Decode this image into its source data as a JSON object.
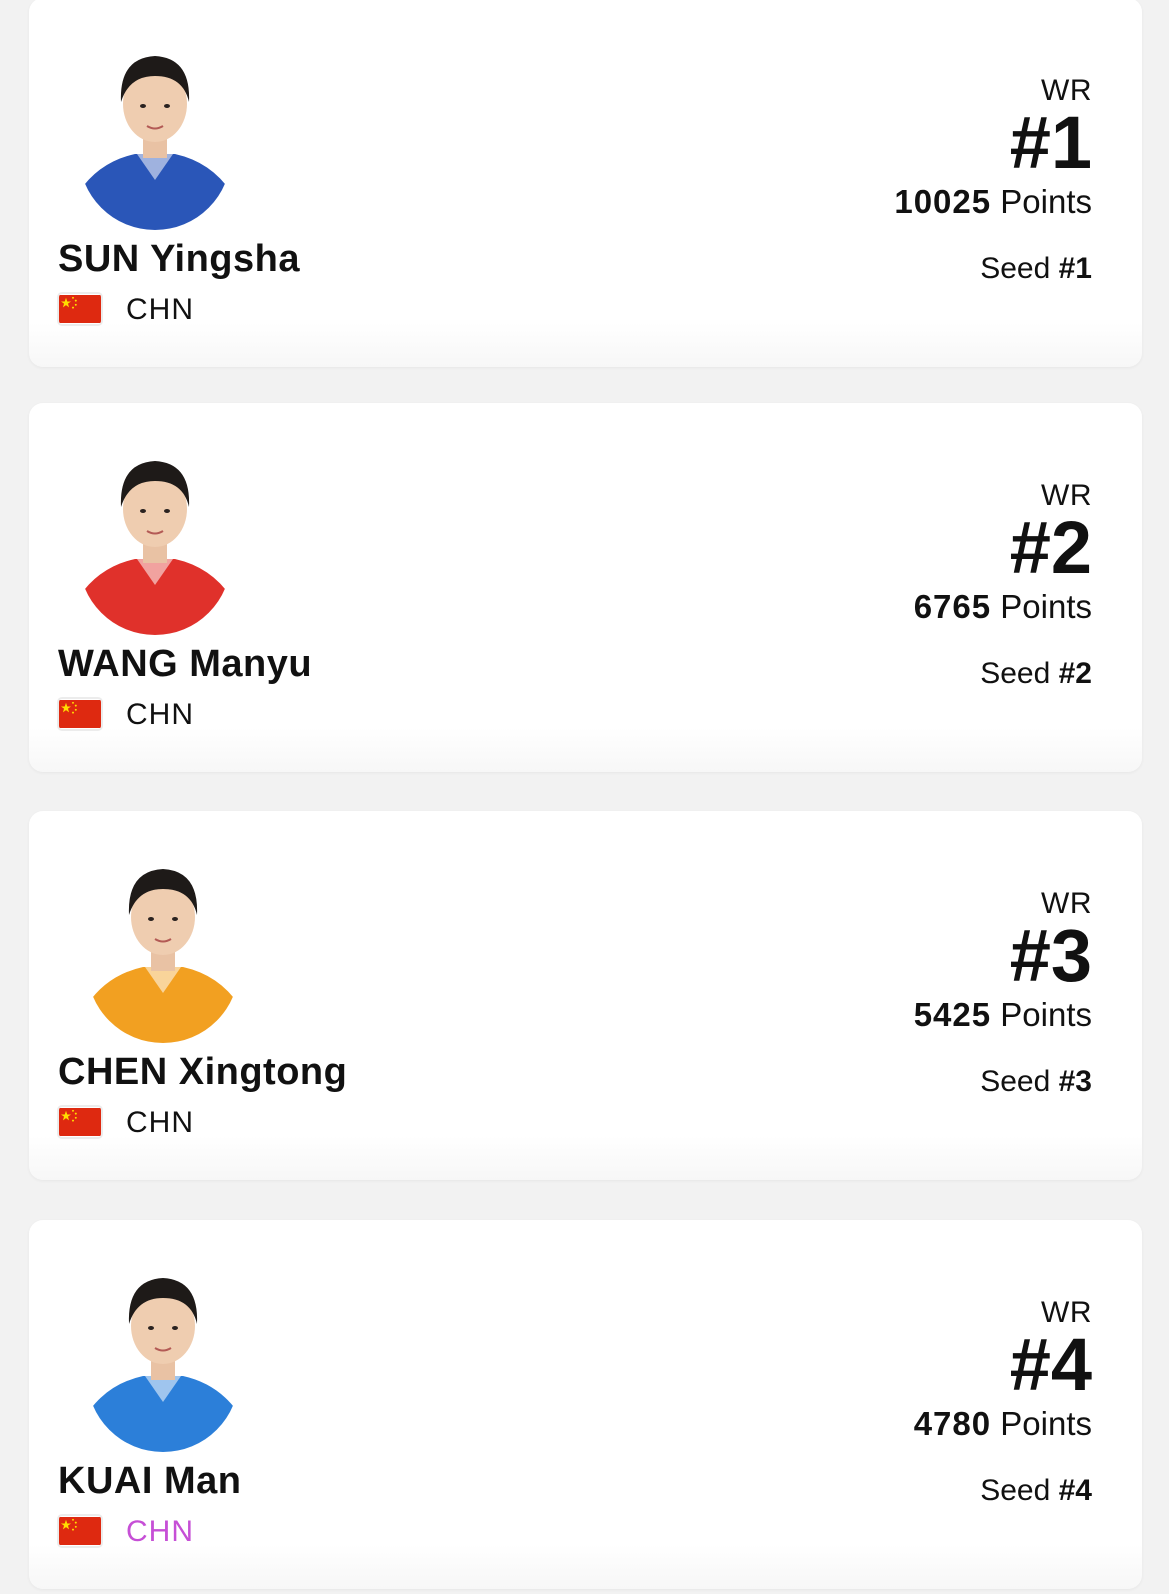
{
  "players": [
    {
      "name": "SUN Yingsha",
      "country": "CHN",
      "wr_label": "WR",
      "rank": "#1",
      "points_value": "10025",
      "points_label": "Points",
      "seed_label": "Seed",
      "seed_value": "#1",
      "flag_icon": "china-flag-icon",
      "jersey_color": "#2a56b8"
    },
    {
      "name": "WANG Manyu",
      "country": "CHN",
      "wr_label": "WR",
      "rank": "#2",
      "points_value": "6765",
      "points_label": "Points",
      "seed_label": "Seed",
      "seed_value": "#2",
      "flag_icon": "china-flag-icon",
      "jersey_color": "#e0312b"
    },
    {
      "name": "CHEN Xingtong",
      "country": "CHN",
      "wr_label": "WR",
      "rank": "#3",
      "points_value": "5425",
      "points_label": "Points",
      "seed_label": "Seed",
      "seed_value": "#3",
      "flag_icon": "china-flag-icon",
      "jersey_color": "#f2a021"
    },
    {
      "name": "KUAI Man",
      "country": "CHN",
      "wr_label": "WR",
      "rank": "#4",
      "points_value": "4780",
      "points_label": "Points",
      "seed_label": "Seed",
      "seed_value": "#4",
      "flag_icon": "china-flag-icon",
      "jersey_color": "#2c7fd9"
    }
  ],
  "colors": {
    "page_background": "#f2f2f2",
    "card_background": "#ffffff",
    "flag_red": "#de2910",
    "flag_yellow": "#ffde00",
    "country_highlight": "#c64fd6"
  }
}
